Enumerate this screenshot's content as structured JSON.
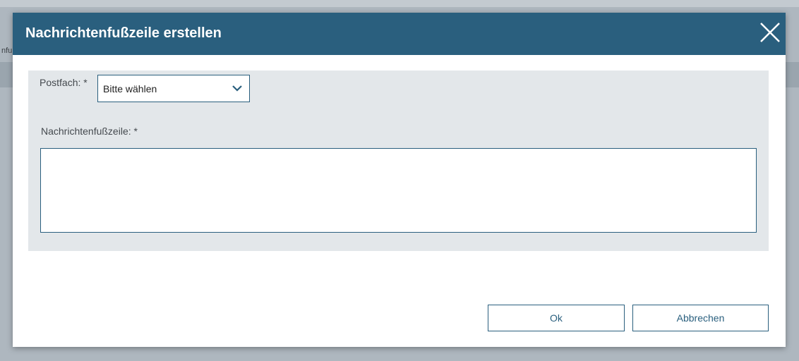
{
  "background": {
    "fragment_text": "nfu"
  },
  "dialog": {
    "title": "Nachrichtenfußzeile erstellen",
    "close_icon": "close-icon",
    "fields": {
      "postfach_label": "Postfach: *",
      "postfach_selected": "Bitte wählen",
      "footer_label": "Nachrichtenfußzeile: *",
      "footer_value": ""
    },
    "buttons": {
      "ok": "Ok",
      "cancel": "Abbrechen"
    }
  },
  "colors": {
    "header": "#2a5f7e",
    "panel": "#e3e7ea",
    "accent": "#2a5f7e"
  }
}
